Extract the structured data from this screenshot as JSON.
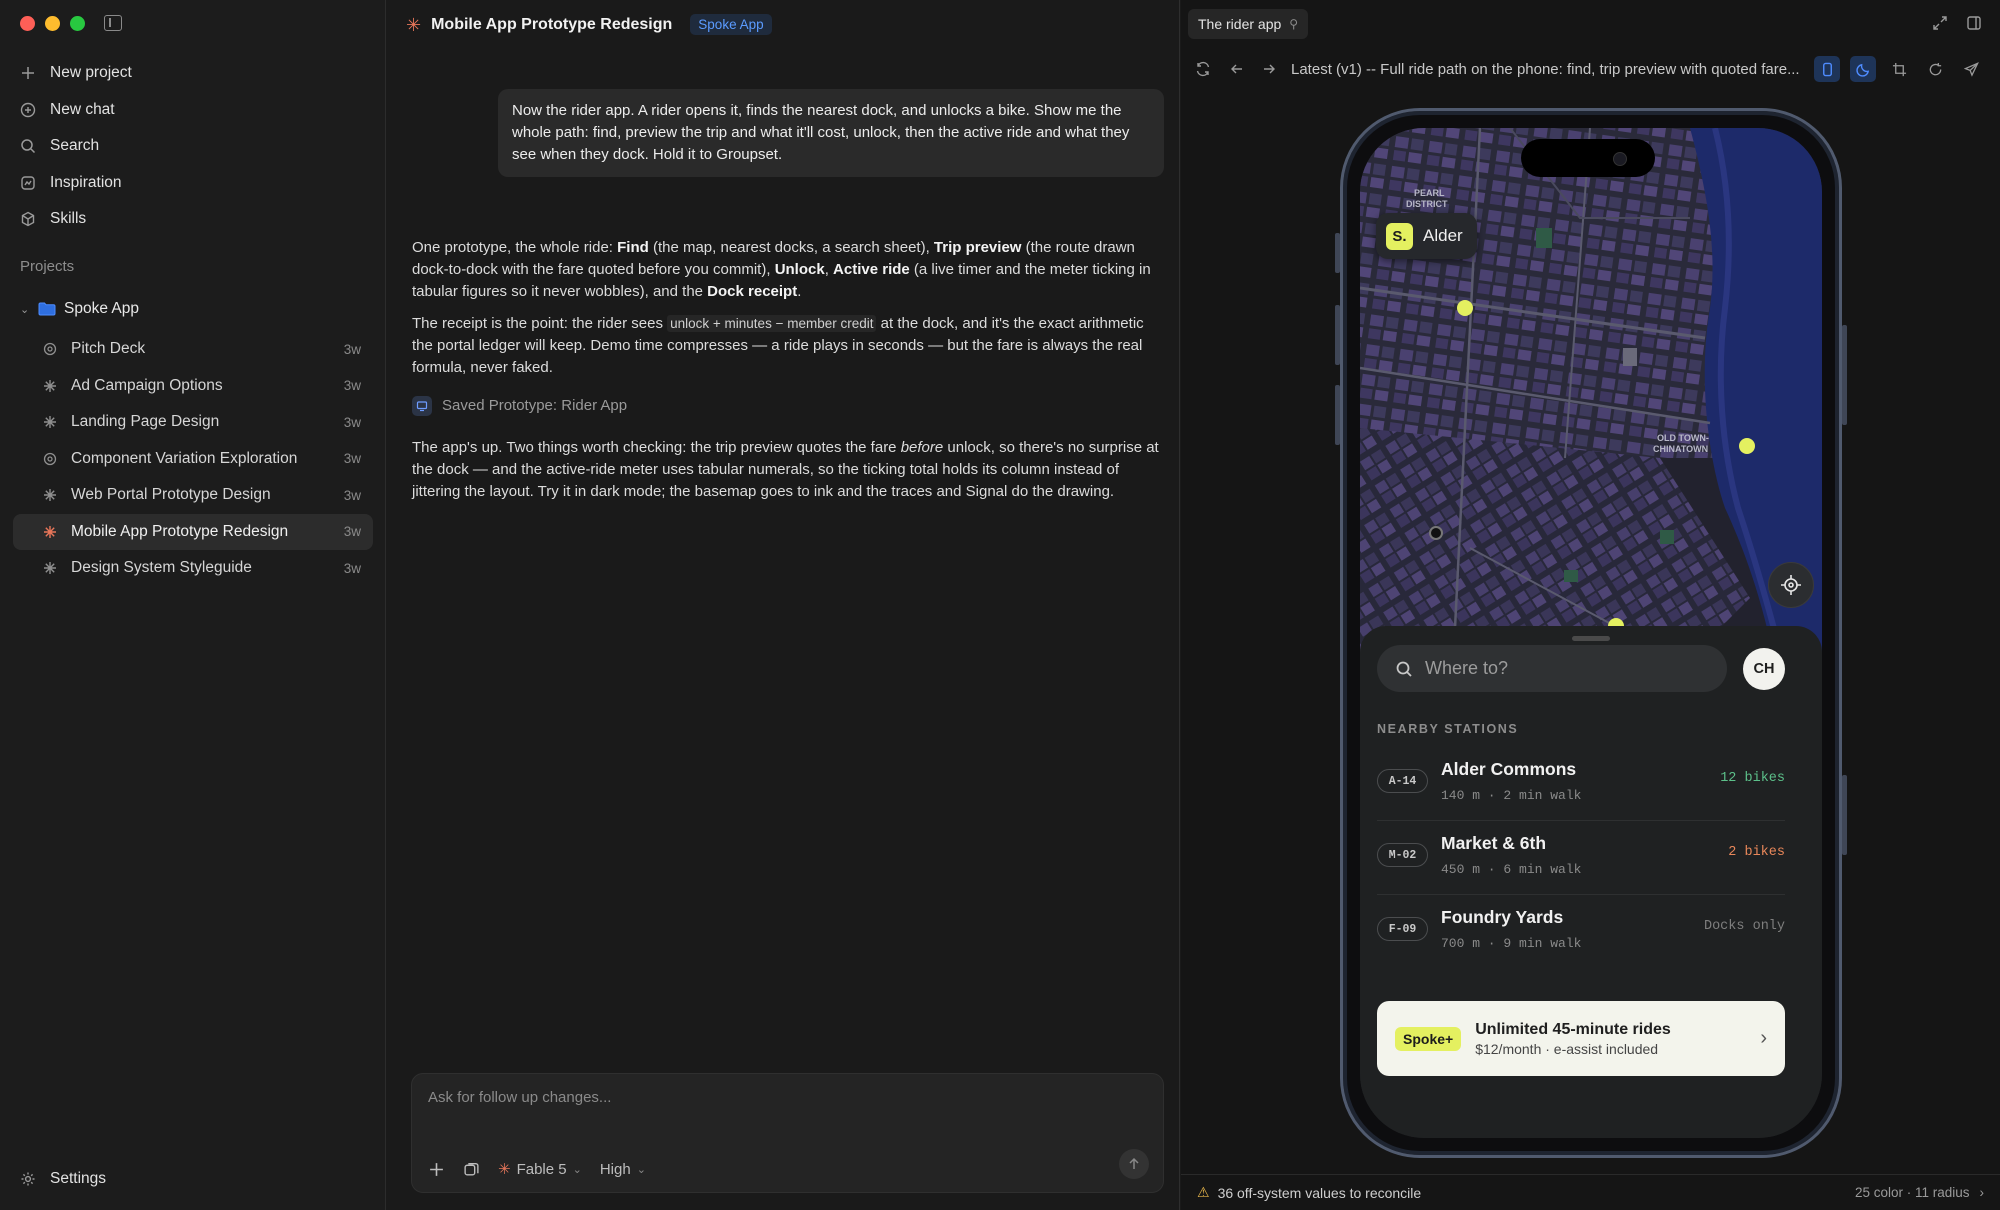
{
  "sidebar": {
    "nav": [
      {
        "label": "New project",
        "icon": "plus-icon"
      },
      {
        "label": "New chat",
        "icon": "chat-plus-icon"
      },
      {
        "label": "Search",
        "icon": "search-icon"
      },
      {
        "label": "Inspiration",
        "icon": "inspiration-icon"
      },
      {
        "label": "Skills",
        "icon": "skills-icon"
      }
    ],
    "projects_title": "Projects",
    "project_root": "Spoke App",
    "projects": [
      {
        "label": "Pitch Deck",
        "time": "3w"
      },
      {
        "label": "Ad Campaign Options",
        "time": "3w"
      },
      {
        "label": "Landing Page Design",
        "time": "3w"
      },
      {
        "label": "Component Variation Exploration",
        "time": "3w"
      },
      {
        "label": "Web Portal Prototype Design",
        "time": "3w"
      },
      {
        "label": "Mobile App Prototype Redesign",
        "time": "3w"
      },
      {
        "label": "Design System Styleguide",
        "time": "3w"
      }
    ],
    "settings": "Settings"
  },
  "chat": {
    "title": "Mobile App Prototype Redesign",
    "badge": "Spoke App",
    "user_message": "Now the rider app. A rider opens it, finds the nearest dock, and unlocks a bike. Show me the whole path: find, preview the trip and what it'll cost, unlock, then the active ride and what they see when they dock. Hold it to Groupset.",
    "p1": {
      "a": "One prototype, the whole ride: ",
      "b_find": "Find",
      "c": " (the map, nearest docks, a search sheet), ",
      "b_trip": "Trip preview",
      "d": " (the route drawn dock-to-dock with the fare quoted before you commit), ",
      "b_unlock": "Unlock",
      "e": ", ",
      "b_active": "Active ride",
      "f": " (a live timer and the meter ticking in tabular figures so it never wobbles), and the ",
      "b_dock": "Dock receipt",
      "g": "."
    },
    "p2": {
      "a": "The receipt is the point: the rider sees ",
      "code": "unlock + minutes − member credit",
      "b": " at the dock, and it's the exact arithmetic the portal ledger will keep. Demo time compresses — a ride plays in seconds — but the fare is always the real formula, never faked."
    },
    "saved": "Saved Prototype: Rider App",
    "p3": {
      "a": "The app's up. Two things worth checking: the trip preview quotes the fare ",
      "em": "before",
      "b": " unlock, so there's no surprise at the dock — and the active-ride meter uses tabular numerals, so the ticking total holds its column instead of jittering the layout. Try it in dark mode; the basemap goes to ink and the traces and Signal do the drawing."
    },
    "composer": {
      "placeholder": "Ask for follow up changes...",
      "model": "Fable 5",
      "effort": "High"
    }
  },
  "preview": {
    "tab": "The rider app",
    "url": "Latest (v1) -- Full ride path on the phone: find, trip preview with quoted fare...",
    "footer_warning": "36 off-system values to reconcile",
    "footer_meta": "25 color · 11 radius",
    "app": {
      "brand_logo": "S.",
      "brand_name": "Alder",
      "search_placeholder": "Where to?",
      "avatar": "CH",
      "section": "NEARBY STATIONS",
      "stations": [
        {
          "code": "A-14",
          "name": "Alder Commons",
          "meta": "140 m · 2 min walk",
          "status": "12 bikes",
          "status_color": "#5cc08a"
        },
        {
          "code": "M-02",
          "name": "Market & 6th",
          "meta": "450 m · 6 min walk",
          "status": "2 bikes",
          "status_color": "#e8875a"
        },
        {
          "code": "F-09",
          "name": "Foundry Yards",
          "meta": "700 m · 9 min walk",
          "status": "Docks only",
          "status_color": "#7e7e7e"
        }
      ],
      "promo": {
        "badge": "Spoke+",
        "title": "Unlimited 45-minute rides",
        "subtitle": "$12/month · e-assist included"
      },
      "map_labels": {
        "pearl": "PEARL",
        "district": "DISTRICT",
        "old_town": "OLD TOWN-",
        "chinatown": "CHINATOWN"
      }
    }
  },
  "colors": {
    "accent": "#e8765a",
    "brand": "#e4f060",
    "link": "#5b9bff"
  }
}
